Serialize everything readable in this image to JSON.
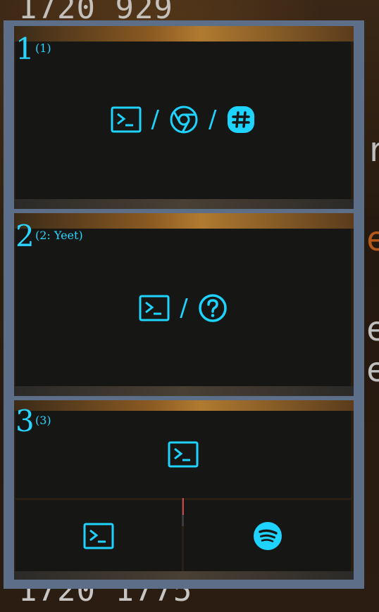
{
  "background": {
    "top_text": "1720 929",
    "bottom_text": "1720 1775",
    "right_chars": [
      "r",
      "e",
      "e",
      "e"
    ]
  },
  "workspaces": [
    {
      "number": "1",
      "label": "(1)",
      "apps": [
        "terminal-icon",
        "chrome-icon",
        "slack-icon"
      ],
      "separator": "/"
    },
    {
      "number": "2",
      "label": "(2: Yeet)",
      "apps": [
        "terminal-icon",
        "unknown-app-icon"
      ],
      "separator": "/"
    },
    {
      "number": "3",
      "label": "(3)",
      "apps": [
        "terminal-icon",
        "terminal-icon",
        "spotify-icon"
      ]
    }
  ],
  "colors": {
    "accent": "#1fd3ff",
    "overview_frame": "#5d6f88",
    "window_bg": "#161715"
  }
}
